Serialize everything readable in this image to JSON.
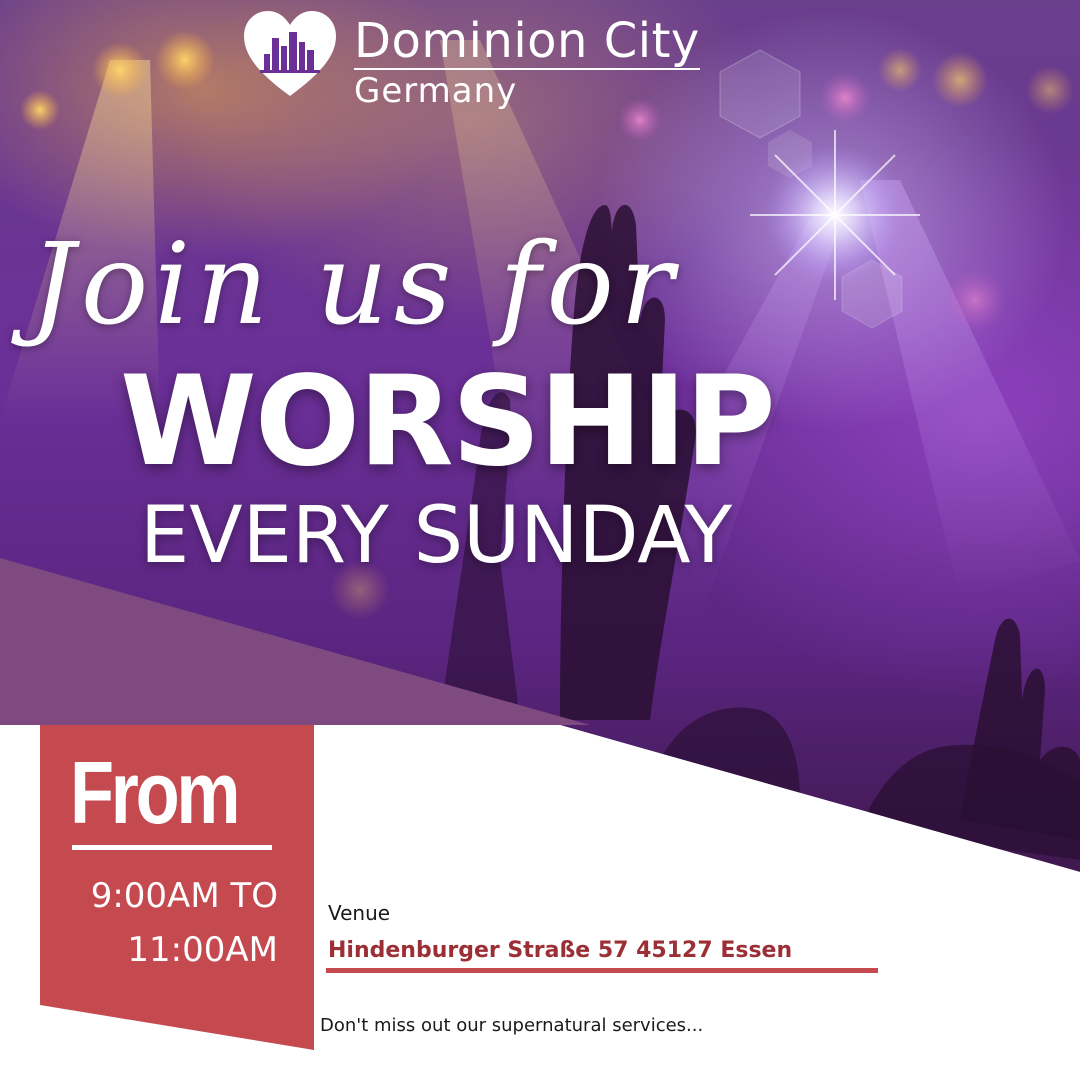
{
  "logo": {
    "name": "Dominion City",
    "subtitle": "Germany",
    "icon": "heart-skyline-icon"
  },
  "headline": {
    "script_line": "Join us for",
    "main": "WORSHIP",
    "sub": "EVERY SUNDAY"
  },
  "schedule": {
    "from_label": "From",
    "start_time": "9:00AM TO",
    "end_time": "11:00AM"
  },
  "venue": {
    "label": "Venue",
    "address": "Hindenburger Straße 57 45127 Essen"
  },
  "tagline": "Don't miss out our supernatural services...",
  "colors": {
    "accent_red": "#c44a50",
    "address_red": "#9c2f36",
    "band_purple": "#7e4a80",
    "bg_purple": "#6b2f98",
    "text_white": "#ffffff"
  }
}
